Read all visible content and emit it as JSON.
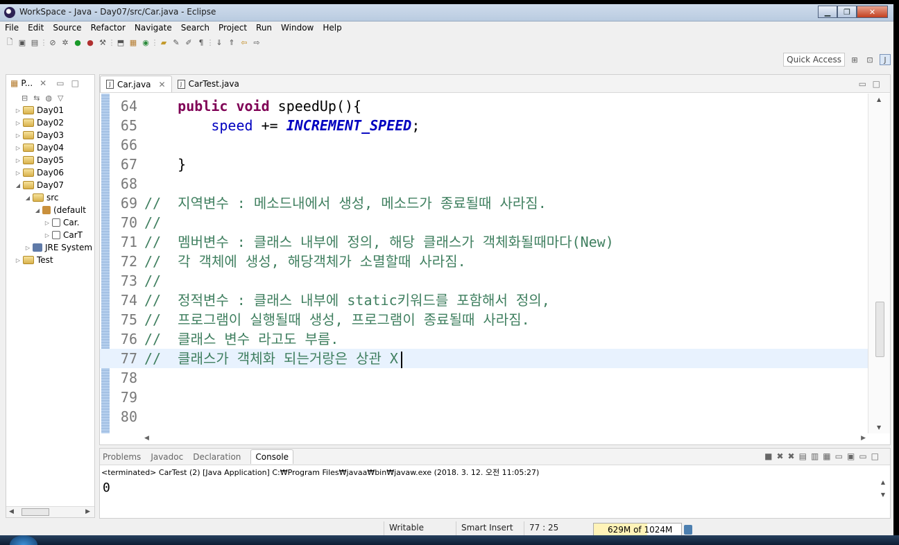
{
  "window": {
    "title": "WorkSpace - Java - Day07/src/Car.java - Eclipse"
  },
  "menu": [
    "File",
    "Edit",
    "Source",
    "Refactor",
    "Navigate",
    "Search",
    "Project",
    "Run",
    "Window",
    "Help"
  ],
  "quick_access": "Quick Access",
  "package_explorer": {
    "tab_label": "P...",
    "items": [
      {
        "label": "Day01",
        "type": "proj",
        "indent": 0,
        "twisty": "▷"
      },
      {
        "label": "Day02",
        "type": "proj",
        "indent": 0,
        "twisty": "▷"
      },
      {
        "label": "Day03",
        "type": "proj",
        "indent": 0,
        "twisty": "▷"
      },
      {
        "label": "Day04",
        "type": "proj",
        "indent": 0,
        "twisty": "▷"
      },
      {
        "label": "Day05",
        "type": "proj",
        "indent": 0,
        "twisty": "▷"
      },
      {
        "label": "Day06",
        "type": "proj",
        "indent": 0,
        "twisty": "▷"
      },
      {
        "label": "Day07",
        "type": "proj",
        "indent": 0,
        "twisty": "◢"
      },
      {
        "label": "src",
        "type": "src",
        "indent": 1,
        "twisty": "◢"
      },
      {
        "label": "(default",
        "type": "pkg",
        "indent": 2,
        "twisty": "◢"
      },
      {
        "label": "Car.",
        "type": "java",
        "indent": 3,
        "twisty": "▷"
      },
      {
        "label": "CarT",
        "type": "java",
        "indent": 3,
        "twisty": "▷"
      },
      {
        "label": "JRE System",
        "type": "jre",
        "indent": 1,
        "twisty": "▷"
      },
      {
        "label": "Test",
        "type": "proj",
        "indent": 0,
        "twisty": "▷"
      }
    ]
  },
  "editor": {
    "tabs": [
      {
        "label": "Car.java",
        "active": true
      },
      {
        "label": "CarTest.java",
        "active": false
      }
    ],
    "lines": [
      {
        "n": "64",
        "segs": [
          {
            "t": "    "
          },
          {
            "t": "public",
            "c": "kw"
          },
          {
            "t": " "
          },
          {
            "t": "void",
            "c": "kw"
          },
          {
            "t": " speedUp(){"
          }
        ]
      },
      {
        "n": "65",
        "segs": [
          {
            "t": "        "
          },
          {
            "t": "speed",
            "c": "fld"
          },
          {
            "t": " += "
          },
          {
            "t": "INCREMENT_SPEED",
            "c": "const"
          },
          {
            "t": ";"
          }
        ]
      },
      {
        "n": "66",
        "segs": []
      },
      {
        "n": "67",
        "segs": [
          {
            "t": "    }"
          }
        ]
      },
      {
        "n": "68",
        "segs": []
      },
      {
        "n": "69",
        "segs": [
          {
            "t": "//  지역변수 : 메소드내에서 생성, 메소드가 종료될때 사라짐.",
            "c": "cmt"
          }
        ]
      },
      {
        "n": "70",
        "segs": [
          {
            "t": "//",
            "c": "cmt"
          }
        ]
      },
      {
        "n": "71",
        "segs": [
          {
            "t": "//  멤버변수 : 클래스 내부에 정의, 해당 클래스가 객체화될때마다(New)",
            "c": "cmt"
          }
        ]
      },
      {
        "n": "72",
        "segs": [
          {
            "t": "//  각 객체에 생성, 해당객체가 소멸할때 사라짐.",
            "c": "cmt"
          }
        ]
      },
      {
        "n": "73",
        "segs": [
          {
            "t": "//",
            "c": "cmt"
          }
        ]
      },
      {
        "n": "74",
        "segs": [
          {
            "t": "//  정적변수 : 클래스 내부에 static키워드를 포함해서 정의,",
            "c": "cmt"
          }
        ]
      },
      {
        "n": "75",
        "segs": [
          {
            "t": "//  프로그램이 실행될때 생성, 프로그램이 종료될때 사라짐.",
            "c": "cmt"
          }
        ]
      },
      {
        "n": "76",
        "segs": [
          {
            "t": "//  클래스 변수 라고도 부름.",
            "c": "cmt"
          }
        ]
      },
      {
        "n": "77",
        "segs": [
          {
            "t": "//  클래스가 객체화 되는거랑은 상관 X",
            "c": "cmt"
          }
        ],
        "current": true
      },
      {
        "n": "78",
        "segs": []
      },
      {
        "n": "79",
        "segs": []
      },
      {
        "n": "80",
        "segs": []
      }
    ]
  },
  "console": {
    "tabs": [
      "Problems",
      "Javadoc",
      "Declaration",
      "Console"
    ],
    "active_tab": "Console",
    "info": "<terminated> CarTest (2) [Java Application] C:₩Program Files₩javaa₩bin₩javaw.exe (2018. 3. 12. 오전 11:05:27)",
    "output": "0"
  },
  "status": {
    "writable": "Writable",
    "insert_mode": "Smart Insert",
    "position": "77 : 25",
    "heap": "629M of 1024M",
    "heap_fraction": 0.614
  }
}
